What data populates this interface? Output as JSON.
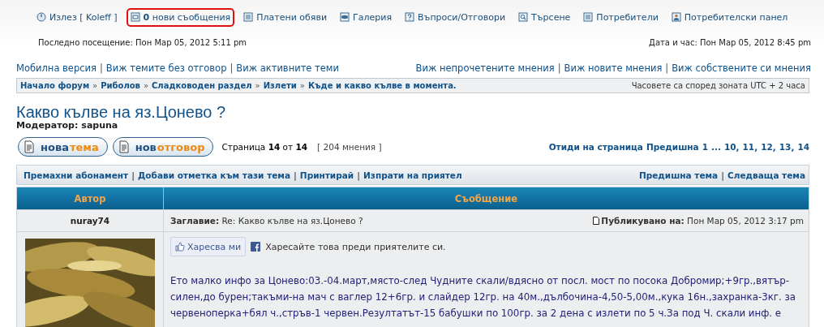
{
  "top_nav": [
    {
      "kind": "logout",
      "label": "Излез [ Koleff ]",
      "highlighted": false
    },
    {
      "kind": "messages",
      "label": "**0** нови съобщения",
      "highlighted": true
    },
    {
      "kind": "list",
      "label": "Платени обяви",
      "highlighted": false
    },
    {
      "kind": "gallery",
      "label": "Галерия",
      "highlighted": false
    },
    {
      "kind": "faq",
      "label": "Въпроси/Отговори",
      "highlighted": false
    },
    {
      "kind": "search",
      "label": "Търсене",
      "highlighted": false
    },
    {
      "kind": "list",
      "label": "Потребители",
      "highlighted": false
    },
    {
      "kind": "user",
      "label": "Потребителски панел",
      "highlighted": false
    }
  ],
  "last_visit": "Последно посещение: Пон Мар 05, 2012 5:11 pm",
  "current_time": "Дата и час: Пон Мар 05, 2012 8:45 pm",
  "links_left": [
    "Мобилна версия",
    "Виж темите без отговор",
    "Виж активните теми"
  ],
  "links_right": [
    "Виж непрочетените мнения",
    "Виж новите мнения",
    "Виж собствените си мнения"
  ],
  "link_separator": "|",
  "breadcrumb_separator": "»",
  "breadcrumb": [
    "Начало форум",
    "Риболов",
    "Сладководен раздел",
    "Излети",
    "Къде и какво кълве в момента."
  ],
  "timezone": "Часовете са според зоната UTC + 2 часа",
  "topic": {
    "title": "Какво кълве на яз.Цонево ?",
    "moderator_label": "Модератор:",
    "moderator": "sapuna"
  },
  "buttons": [
    {
      "first": "нова",
      "second": "тема"
    },
    {
      "first": "нов",
      "second": "отговор"
    }
  ],
  "page_info": "Страница **14** от **14**",
  "post_count": "[ 204 мнения ]",
  "pagination": {
    "label": "Отиди на страница",
    "prev": "Предишна",
    "pages": [
      "1",
      "...",
      "10,",
      "11,",
      "12,",
      "13,",
      "14"
    ]
  },
  "actions_left": [
    "Премахни абонамент",
    "Добави отметка към тази тема",
    "Принтирай",
    "Изпрати на приятел"
  ],
  "actions_right": [
    "Предишна тема",
    "Следваща тема"
  ],
  "table": {
    "columns": [
      "Автор",
      "Съобщение"
    ],
    "post": {
      "author": "nuray74",
      "subject": "**Заглавие:** Re: Какво кълве на яз.Цонево ?",
      "posted": "**Публикувано на:** Пон Мар 05, 2012 3:17 pm",
      "like": "Харесва ми",
      "like_note": "Харесайте това преди приятелите си.",
      "body": "Ето малко инфо за Цонево:03.-04.март,място-след Чудните скали/вдясно от посл. мост по посока Добромир;+9гр.,вятър-силен,до бурен;такъми-на мач с ваглер 12+6гр. и слайдер 12гр. на 40м.,дълбочина-4,50-5,00м.,кука 16н.,захранка-3кг. за червеноперка+бял ч.,стръв-1 червен.Резултатът-15 бабушки по 100гр. за 2 дена с излети по 5 ч.За под Ч. скали инф. е"
    }
  }
}
